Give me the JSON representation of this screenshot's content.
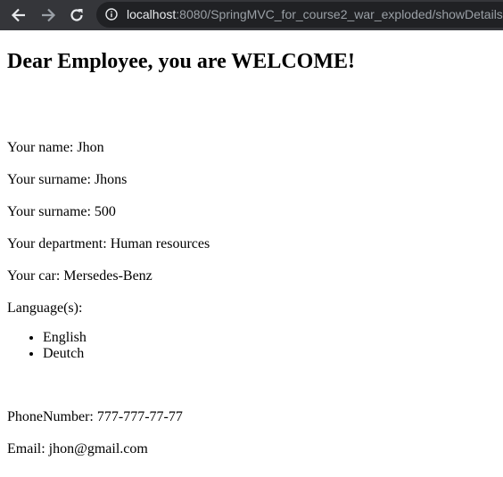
{
  "browser": {
    "url_host": "localhost",
    "url_rest": ":8080/SpringMVC_for_course2_war_exploded/showDetails",
    "icons": [
      "back-arrow-icon",
      "forward-arrow-icon",
      "reload-icon",
      "info-icon"
    ]
  },
  "page": {
    "heading": "Dear Employee, you are WELCOME!",
    "name_line": "Your name: Jhon",
    "surname_line": "Your surname: Jhons",
    "salary_line": "Your surname: 500",
    "department_line": "Your department: Human resources",
    "car_line": "Your car: Mersedes-Benz",
    "languages_label": "Language(s):",
    "languages": [
      "English",
      "Deutch"
    ],
    "phone_line": "PhoneNumber: 777-777-77-77",
    "email_line": "Email: jhon@gmail.com"
  }
}
